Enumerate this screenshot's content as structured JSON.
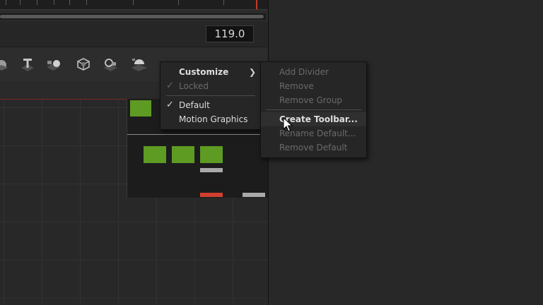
{
  "timecode": {
    "value": "119.0"
  },
  "toolbar": {
    "icons": [
      "sphere-icon",
      "text-tool-icon",
      "merge-3d-icon",
      "shape-3d-icon",
      "camera-3d-icon",
      "spotlight-icon"
    ]
  },
  "context_menu": {
    "items": [
      {
        "label": "Customize",
        "state": "enabled",
        "has_submenu": true
      },
      {
        "label": "Locked",
        "state": "disabled",
        "checked": true
      },
      {
        "label": "Default",
        "state": "enabled",
        "checked": true
      },
      {
        "label": "Motion Graphics",
        "state": "enabled",
        "checked": false
      }
    ]
  },
  "submenu": {
    "items": [
      {
        "label": "Add Divider",
        "state": "disabled"
      },
      {
        "label": "Remove",
        "state": "disabled"
      },
      {
        "label": "Remove Group",
        "state": "disabled"
      },
      {
        "label": "Create Toolbar...",
        "state": "enabled",
        "hovered": true
      },
      {
        "label": "Rename Default...",
        "state": "disabled"
      },
      {
        "label": "Remove Default",
        "state": "disabled"
      }
    ]
  },
  "colors": {
    "node_green": "#5e9b22",
    "accent_red": "#d1402f",
    "bar_gray": "#a9a9a9",
    "playhead": "#c23b2c"
  }
}
